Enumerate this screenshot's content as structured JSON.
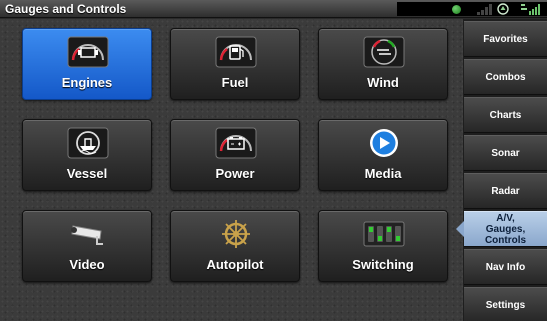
{
  "window": {
    "title": "Gauges and Controls"
  },
  "status": {
    "indicator_color": "#2e9b2e",
    "icons": [
      "status-dot-icon",
      "signal-bars-icon",
      "gps-icon",
      "sat-signal-icon"
    ]
  },
  "tiles": [
    {
      "label": "Engines",
      "icon": "engine-icon",
      "selected": true
    },
    {
      "label": "Fuel",
      "icon": "fuel-pump-icon",
      "selected": false
    },
    {
      "label": "Wind",
      "icon": "wind-icon",
      "selected": false
    },
    {
      "label": "Vessel",
      "icon": "vessel-icon",
      "selected": false
    },
    {
      "label": "Power",
      "icon": "battery-icon",
      "selected": false
    },
    {
      "label": "Media",
      "icon": "play-icon",
      "selected": false
    },
    {
      "label": "Video",
      "icon": "camera-icon",
      "selected": false
    },
    {
      "label": "Autopilot",
      "icon": "helm-wheel-icon",
      "selected": false
    },
    {
      "label": "Switching",
      "icon": "switch-panel-icon",
      "selected": false
    }
  ],
  "sidebar": {
    "items": [
      {
        "label": "Favorites",
        "active": false
      },
      {
        "label": "Combos",
        "active": false
      },
      {
        "label": "Charts",
        "active": false
      },
      {
        "label": "Sonar",
        "active": false
      },
      {
        "label": "Radar",
        "active": false
      },
      {
        "label": "A/V, Gauges, Controls",
        "active": true
      },
      {
        "label": "Nav Info",
        "active": false
      },
      {
        "label": "Settings",
        "active": false
      }
    ]
  },
  "colors": {
    "selected_tile": "#1e6ad8",
    "active_sidebar": "#a8c0de"
  }
}
